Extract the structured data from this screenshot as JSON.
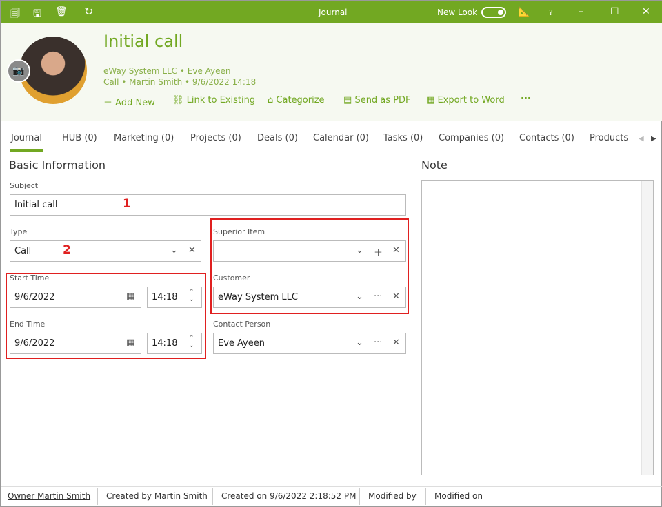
{
  "window": {
    "title": "Journal",
    "new_look_label": "New Look",
    "new_look_on": true,
    "help": "?"
  },
  "colors": {
    "accent": "#72a822",
    "highlight": "#e02020"
  },
  "header": {
    "title": "Initial call",
    "line1": [
      "eWay System LLC",
      "Eve Ayeen"
    ],
    "line2": [
      "Call",
      "Martin Smith",
      "9/6/2022 14:18"
    ],
    "actions": [
      {
        "label": "Add New",
        "icon": "plus-icon"
      },
      {
        "label": "Link to Existing",
        "icon": "link-icon"
      },
      {
        "label": "Categorize",
        "icon": "tag-icon"
      },
      {
        "label": "Send as PDF",
        "icon": "pdf-icon"
      },
      {
        "label": "Export to Word",
        "icon": "word-icon"
      }
    ],
    "more": "···"
  },
  "tabs": [
    "Journal",
    "HUB (0)",
    "Marketing (0)",
    "Projects (0)",
    "Deals (0)",
    "Calendar (0)",
    "Tasks (0)",
    "Companies (0)",
    "Contacts (0)",
    "Products ("
  ],
  "active_tab": "Journal",
  "basic": {
    "heading": "Basic Information",
    "subject": {
      "label": "Subject",
      "value": "Initial call"
    },
    "type": {
      "label": "Type",
      "value": "Call"
    },
    "start": {
      "label": "Start Time",
      "date": "9/6/2022",
      "time": "14:18"
    },
    "end": {
      "label": "End Time",
      "date": "9/6/2022",
      "time": "14:18"
    },
    "superior": {
      "label": "Superior Item",
      "value": ""
    },
    "customer": {
      "label": "Customer",
      "value": "eWay System LLC"
    },
    "contact": {
      "label": "Contact Person",
      "value": "Eve Ayeen"
    }
  },
  "note": {
    "heading": "Note",
    "value": ""
  },
  "annotations": [
    "1",
    "2"
  ],
  "footer": {
    "owner": "Owner Martin Smith",
    "created_by": "Created by Martin Smith",
    "created_on": "Created on 9/6/2022 2:18:52 PM",
    "modified_by": "Modified by",
    "modified_on": "Modified on"
  }
}
